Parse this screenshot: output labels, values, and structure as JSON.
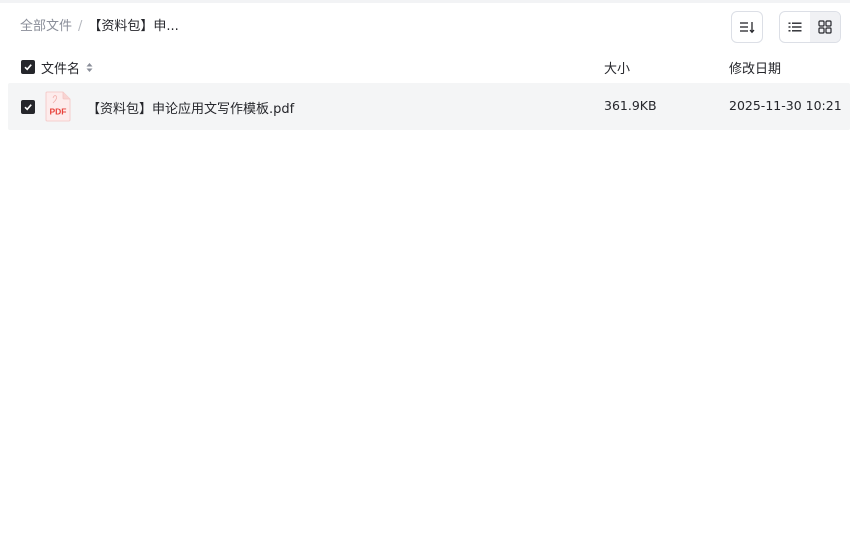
{
  "breadcrumb": {
    "root": "全部文件",
    "separator": "/",
    "current": "【资料包】申..."
  },
  "toolbar": {
    "sort_icon": "sort-lines-icon",
    "list_view_icon": "list-view-icon",
    "grid_view_icon": "grid-view-icon"
  },
  "table": {
    "headers": {
      "name": "文件名",
      "size": "大小",
      "modified": "修改日期"
    },
    "rows": [
      {
        "icon": "pdf-file-icon",
        "icon_label": "PDF",
        "name": "【资料包】申论应用文写作模板.pdf",
        "size": "361.9KB",
        "modified": "2025-11-30 10:21",
        "checked": true
      }
    ]
  },
  "colors": {
    "text": "#25262b",
    "muted": "#8a8e99",
    "row_bg": "#f4f5f6",
    "pdf_red": "#e8423b",
    "border": "#dcdfe6"
  }
}
